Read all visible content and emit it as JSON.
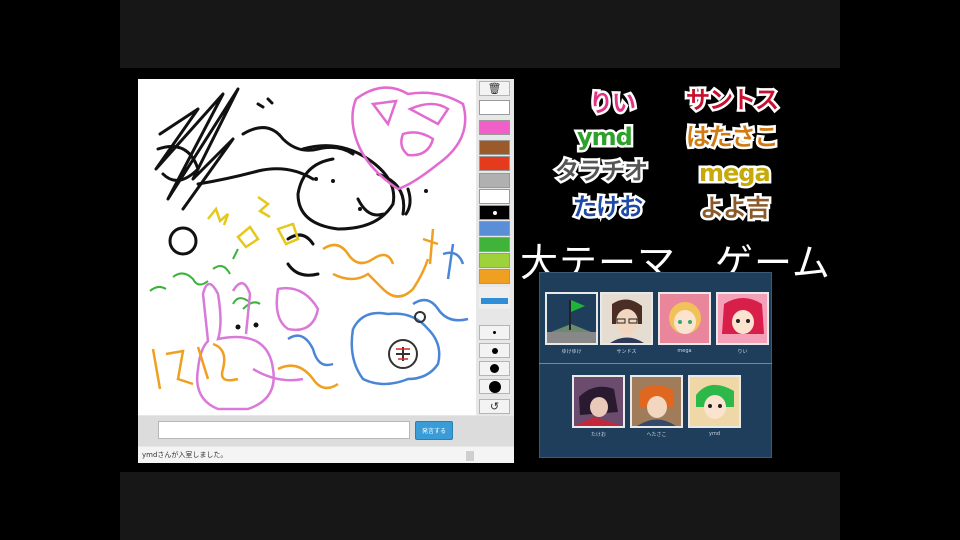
{
  "participants": [
    {
      "name": "りい",
      "color": "#e23384"
    },
    {
      "name": "サントス",
      "color": "#c8102e"
    },
    {
      "name": "ymd",
      "color": "#2fa12a"
    },
    {
      "name": "はたさこ",
      "color": "#d27a12"
    },
    {
      "name": "タラチオ",
      "color": "#555555"
    },
    {
      "name": "mega",
      "color": "#c7a90a"
    },
    {
      "name": "たけお",
      "color": "#1d4aa6"
    },
    {
      "name": "よよ吉",
      "color": "#8a5a2a"
    }
  ],
  "theme_label": "大テーマ　ゲーム",
  "palette": {
    "colors": [
      "#ffffff",
      "#f060c8",
      "#9a5a2a",
      "#e53a1c",
      "#b0b0b0",
      "#ffffff",
      "#000000",
      "#5a8fd8",
      "#3fb33a",
      "#9fd23a",
      "#f0a020"
    ],
    "line_sizes": [
      "small",
      "medium",
      "large",
      "xlarge"
    ],
    "undo_icon": "undo-icon",
    "trash_icon": "trash-icon"
  },
  "chat": {
    "input_value": "",
    "send_label": "発言する",
    "log_message": "ymdさんが入室しました。"
  },
  "members_panel": {
    "row1": [
      {
        "label": "ゆけゆけ"
      },
      {
        "label": "サンドス"
      },
      {
        "label": "mega"
      },
      {
        "label": "りい"
      }
    ],
    "row2": [
      {
        "label": "たけお"
      },
      {
        "label": "ヘたさこ"
      },
      {
        "label": "ymd"
      }
    ]
  }
}
